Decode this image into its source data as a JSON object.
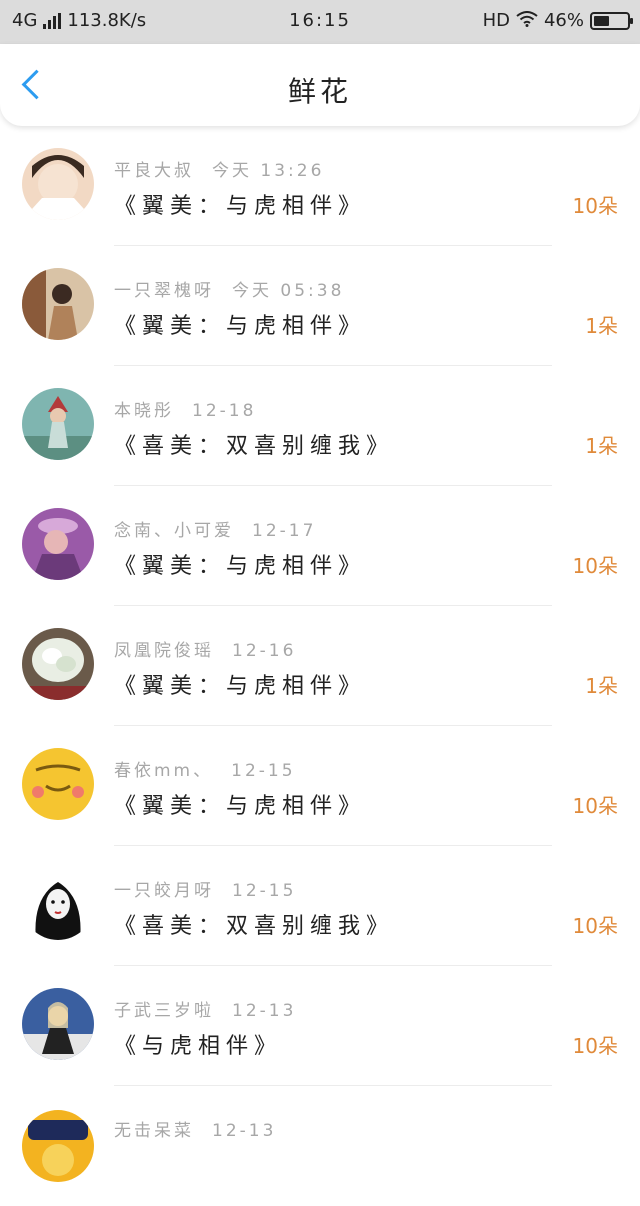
{
  "status_bar": {
    "network": "4G",
    "speed": "113.8K/s",
    "time": "16:15",
    "hd": "HD",
    "battery": "46%",
    "battery_level": 0.46
  },
  "nav": {
    "title": "鲜花"
  },
  "colors": {
    "accent": "#2d9cf0",
    "count": "#e08a3a",
    "meta": "#a7a7a7"
  },
  "items": [
    {
      "name": "平良大叔",
      "time": "今天 13:26",
      "gift": "《翼美：与虎相伴》",
      "count": "10朵"
    },
    {
      "name": "一只翠槐呀",
      "time": "今天 05:38",
      "gift": "《翼美：与虎相伴》",
      "count": "1朵"
    },
    {
      "name": "本晓彤",
      "time": "12-18",
      "gift": "《喜美：双喜别缠我》",
      "count": "1朵"
    },
    {
      "name": "念南、小可爱",
      "time": "12-17",
      "gift": "《翼美：与虎相伴》",
      "count": "10朵"
    },
    {
      "name": "凤凰院俊瑶",
      "time": "12-16",
      "gift": "《翼美：与虎相伴》",
      "count": "1朵"
    },
    {
      "name": "春依mm、",
      "time": "12-15",
      "gift": "《翼美：与虎相伴》",
      "count": "10朵"
    },
    {
      "name": "一只皎月呀",
      "time": "12-15",
      "gift": "《喜美：双喜别缠我》",
      "count": "10朵"
    },
    {
      "name": "子武三岁啦",
      "time": "12-13",
      "gift": "《与虎相伴》",
      "count": "10朵"
    },
    {
      "name": "无击呆菜",
      "time": "12-13",
      "gift": "",
      "count": ""
    }
  ]
}
